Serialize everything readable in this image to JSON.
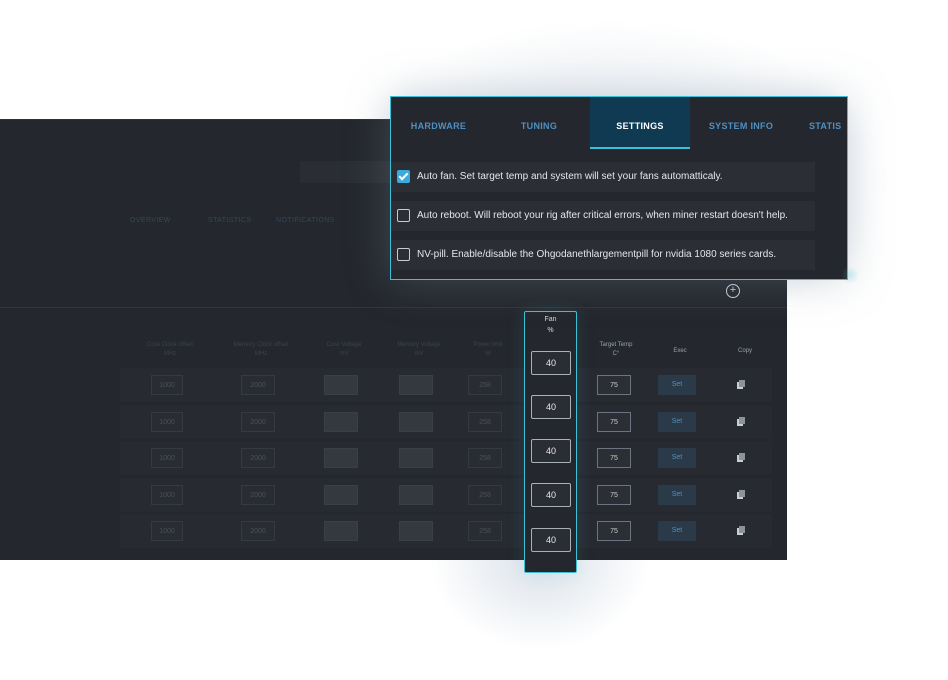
{
  "background": {
    "tabs": [
      "Overview",
      "Statistics",
      "Notifications"
    ],
    "columns": [
      {
        "line1": "Core Clock offset",
        "line2": "MHz"
      },
      {
        "line1": "Memory Clock offset",
        "line2": "MHz"
      },
      {
        "line1": "Core Voltage",
        "line2": "mV"
      },
      {
        "line1": "Memory Voltage",
        "line2": "mV"
      },
      {
        "line1": "Power limit",
        "line2": "W"
      }
    ],
    "right_columns": [
      {
        "line1": "Target Temp",
        "line2": "C°"
      },
      {
        "line1": "Exec",
        "line2": ""
      },
      {
        "line1": "Copy",
        "line2": ""
      }
    ],
    "fan_column": {
      "line1": "Fan",
      "line2": "%"
    },
    "rows": [
      {
        "core": "1000",
        "mem": "2000",
        "power": "258",
        "fan": "40",
        "temp": "75",
        "exec": "Set"
      },
      {
        "core": "1000",
        "mem": "2000",
        "power": "258",
        "fan": "40",
        "temp": "75",
        "exec": "Set"
      },
      {
        "core": "1000",
        "mem": "2000",
        "power": "258",
        "fan": "40",
        "temp": "75",
        "exec": "Set"
      },
      {
        "core": "1000",
        "mem": "2000",
        "power": "258",
        "fan": "40",
        "temp": "75",
        "exec": "Set"
      },
      {
        "core": "1000",
        "mem": "2000",
        "power": "258",
        "fan": "40",
        "temp": "75",
        "exec": "Set"
      }
    ]
  },
  "popup": {
    "tabs": [
      {
        "label": "HARDWARE",
        "active": false
      },
      {
        "label": "TUNING",
        "active": false
      },
      {
        "label": "SETTINGS",
        "active": true
      },
      {
        "label": "SYSTEM INFO",
        "active": false
      },
      {
        "label": "STATIS",
        "active": false
      }
    ],
    "options": [
      {
        "label": "Auto fan. Set target temp and system will set your fans automatticaly.",
        "checked": true
      },
      {
        "label": "Auto reboot. Will reboot your rig after critical errors, when miner restart doesn't help.",
        "checked": false
      },
      {
        "label": "NV-pill. Enable/disable the Ohgodanethlargementpill for nvidia 1080 series cards.",
        "checked": false
      }
    ]
  },
  "colors": {
    "accent": "#3dc0d5",
    "tab_text": "#4e90c2",
    "checkbox_on": "#3ea9dd",
    "panel_bg": "#24272d"
  }
}
